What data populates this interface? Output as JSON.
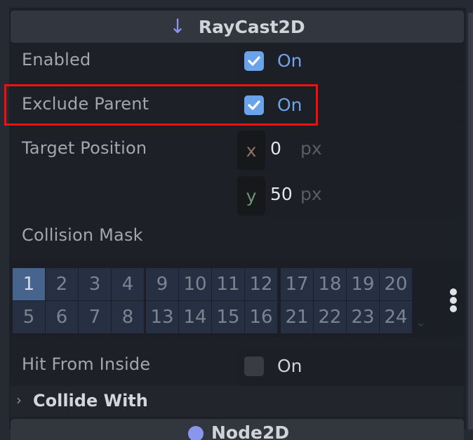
{
  "inspector": {
    "section_title": "RayCast2D",
    "section_icon": "raycast-arrow-down-icon",
    "properties": {
      "enabled": {
        "label": "Enabled",
        "checked": true,
        "text": "On"
      },
      "exclude_parent": {
        "label": "Exclude Parent",
        "checked": true,
        "text": "On",
        "highlighted": true
      },
      "target_position": {
        "label": "Target Position",
        "x": {
          "axis": "x",
          "value": "0",
          "unit": "px"
        },
        "y": {
          "axis": "y",
          "value": "50",
          "unit": "px"
        }
      },
      "collision_mask": {
        "label": "Collision Mask",
        "layers": [
          {
            "n": "1",
            "on": true
          },
          {
            "n": "2",
            "on": false
          },
          {
            "n": "3",
            "on": false
          },
          {
            "n": "4",
            "on": false
          },
          {
            "n": "5",
            "on": false
          },
          {
            "n": "6",
            "on": false
          },
          {
            "n": "7",
            "on": false
          },
          {
            "n": "8",
            "on": false
          },
          {
            "n": "9",
            "on": false
          },
          {
            "n": "10",
            "on": false
          },
          {
            "n": "11",
            "on": false
          },
          {
            "n": "12",
            "on": false
          },
          {
            "n": "13",
            "on": false
          },
          {
            "n": "14",
            "on": false
          },
          {
            "n": "15",
            "on": false
          },
          {
            "n": "16",
            "on": false
          },
          {
            "n": "17",
            "on": false
          },
          {
            "n": "18",
            "on": false
          },
          {
            "n": "19",
            "on": false
          },
          {
            "n": "20",
            "on": false
          },
          {
            "n": "21",
            "on": false
          },
          {
            "n": "22",
            "on": false
          },
          {
            "n": "23",
            "on": false
          },
          {
            "n": "24",
            "on": false
          }
        ]
      },
      "hit_from_inside": {
        "label": "Hit From Inside",
        "checked": false,
        "text": "On"
      }
    },
    "group_collide_with": "Collide With",
    "next_section_title": "Node2D"
  },
  "colors": {
    "accent": "#6aa3ea",
    "highlight_border": "#f10f0f",
    "axis_x": "#8f7466",
    "axis_y": "#6d9672",
    "layer_on": "#46648e",
    "layer_off": "#263042"
  }
}
